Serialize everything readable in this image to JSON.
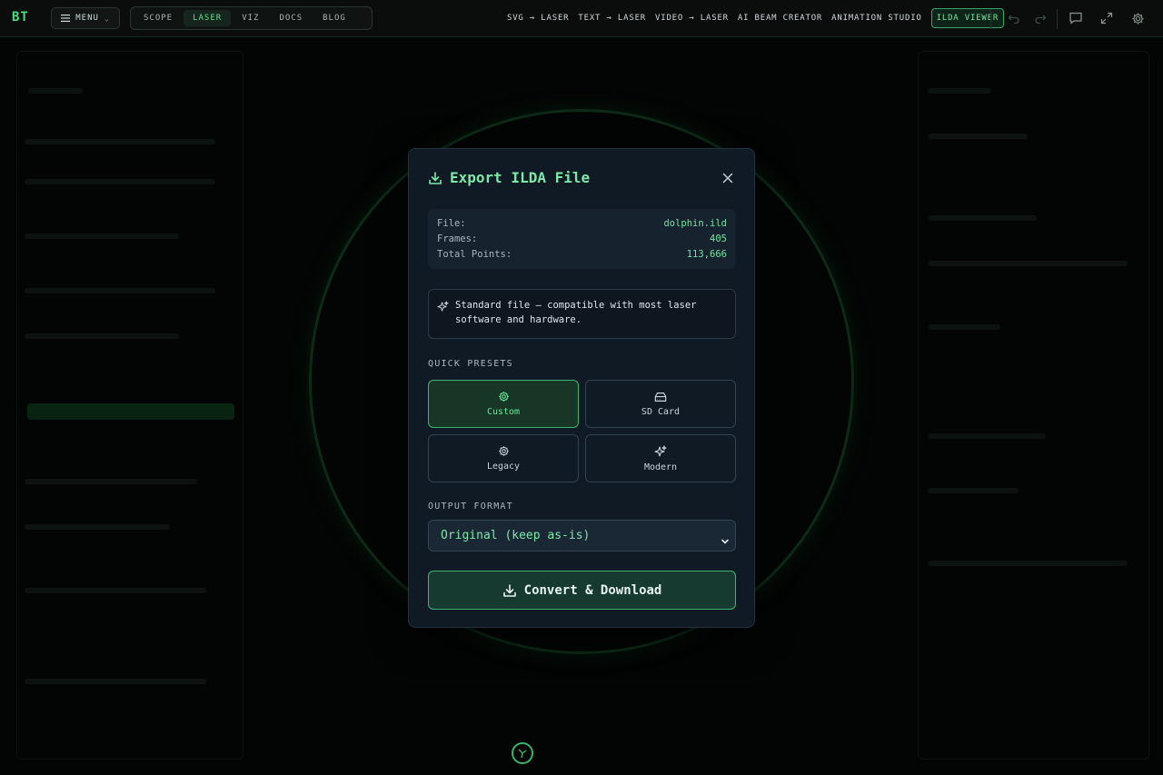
{
  "app": {
    "logo": "BT",
    "menu_label": "MENU"
  },
  "nav": {
    "tabs": [
      {
        "label": "SCOPE"
      },
      {
        "label": "LASER"
      },
      {
        "label": "VIZ"
      },
      {
        "label": "DOCS"
      },
      {
        "label": "BLOG"
      }
    ],
    "active_tab": "LASER"
  },
  "tools": {
    "links": [
      {
        "label": "SVG → LASER"
      },
      {
        "label": "TEXT → LASER"
      },
      {
        "label": "VIDEO → LASER"
      },
      {
        "label": "AI BEAM CREATOR"
      },
      {
        "label": "ANIMATION STUDIO"
      },
      {
        "label": "ILDA VIEWER"
      }
    ],
    "active": "ILDA VIEWER"
  },
  "toolbar_icons": [
    "undo-icon",
    "redo-icon",
    "comment-icon",
    "expand-icon",
    "gear-icon"
  ],
  "modal": {
    "title": "Export ILDA File",
    "file_info": {
      "rows": [
        {
          "key": "File:",
          "value": "dolphin.ild"
        },
        {
          "key": "Frames:",
          "value": "405"
        },
        {
          "key": "Total Points:",
          "value": "113,666"
        }
      ]
    },
    "note": "Standard file — compatible with most laser software and hardware.",
    "presets": {
      "label": "QUICK PRESETS",
      "items": [
        {
          "label": "Custom",
          "icon": "gear-icon"
        },
        {
          "label": "SD Card",
          "icon": "sd-card-icon"
        },
        {
          "label": "Legacy",
          "icon": "gear-icon"
        },
        {
          "label": "Modern",
          "icon": "sparkles-icon"
        }
      ],
      "active": "Custom"
    },
    "output": {
      "label": "OUTPUT FORMAT",
      "selected": "Original (keep as-is)"
    },
    "convert_label": "Convert & Download"
  },
  "colors": {
    "accent": "#4ade80",
    "modal_bg": "#101a24",
    "button_bg": "#173a30"
  }
}
